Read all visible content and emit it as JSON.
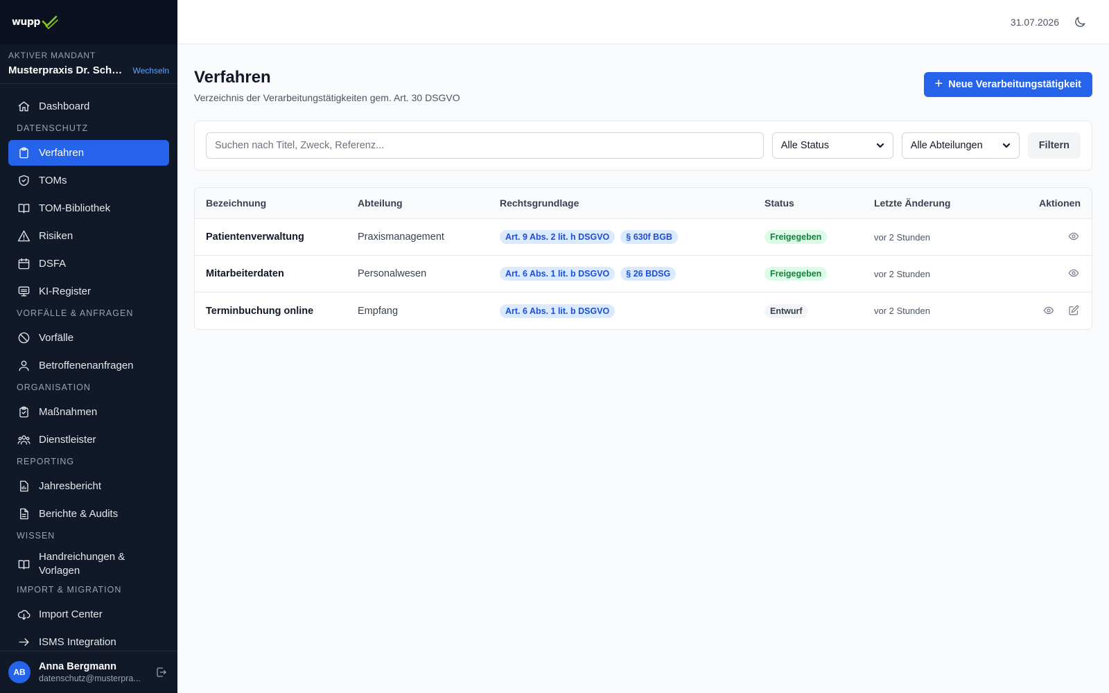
{
  "app": {
    "logo_text": "wupp"
  },
  "tenant": {
    "label": "AKTIVER MANDANT",
    "name": "Musterpraxis Dr. Schmi...",
    "switch_label": "Wechseln"
  },
  "sidebar": {
    "items": [
      {
        "type": "item",
        "label": "Dashboard",
        "icon": "home-icon"
      },
      {
        "type": "section",
        "label": "DATENSCHUTZ"
      },
      {
        "type": "item",
        "label": "Verfahren",
        "icon": "clipboard-icon",
        "active": true
      },
      {
        "type": "item",
        "label": "TOMs",
        "icon": "shield-icon"
      },
      {
        "type": "item",
        "label": "TOM-Bibliothek",
        "icon": "book-icon"
      },
      {
        "type": "item",
        "label": "Risiken",
        "icon": "warning-icon"
      },
      {
        "type": "item",
        "label": "DSFA",
        "icon": "calendar-icon"
      },
      {
        "type": "item",
        "label": "KI-Register",
        "icon": "monitor-icon"
      },
      {
        "type": "section",
        "label": "VORFÄLLE & ANFRAGEN"
      },
      {
        "type": "item",
        "label": "Vorfälle",
        "icon": "ban-icon"
      },
      {
        "type": "item",
        "label": "Betroffenenanfragen",
        "icon": "user-icon"
      },
      {
        "type": "section",
        "label": "ORGANISATION"
      },
      {
        "type": "item",
        "label": "Maßnahmen",
        "icon": "clipboard-check-icon"
      },
      {
        "type": "item",
        "label": "Dienstleister",
        "icon": "users-icon"
      },
      {
        "type": "section",
        "label": "REPORTING"
      },
      {
        "type": "item",
        "label": "Jahresbericht",
        "icon": "report-chart-icon"
      },
      {
        "type": "item",
        "label": "Berichte & Audits",
        "icon": "document-icon"
      },
      {
        "type": "section",
        "label": "WISSEN"
      },
      {
        "type": "item",
        "label": "Handreichungen & Vorlagen",
        "icon": "book-icon",
        "two_line": true
      },
      {
        "type": "section",
        "label": "IMPORT & MIGRATION"
      },
      {
        "type": "item",
        "label": "Import Center",
        "icon": "cloud-download-icon"
      },
      {
        "type": "item",
        "label": "ISMS Integration",
        "icon": "arrow-right-icon"
      }
    ]
  },
  "user": {
    "initials": "AB",
    "name": "Anna Bergmann",
    "email": "datenschutz@musterpra..."
  },
  "topbar": {
    "date": "31.07.2026",
    "theme_icon": "moon-icon"
  },
  "page": {
    "title": "Verfahren",
    "subtitle": "Verzeichnis der Verarbeitungstätigkeiten gem. Art. 30 DSGVO",
    "new_button_label": "Neue Verarbeitungstätigkeit"
  },
  "filters": {
    "search_placeholder": "Suchen nach Titel, Zweck, Referenz...",
    "status_selected": "Alle Status",
    "dept_selected": "Alle Abteilungen",
    "filter_button_label": "Filtern"
  },
  "table": {
    "columns": [
      "Bezeichnung",
      "Abteilung",
      "Rechtsgrundlage",
      "Status",
      "Letzte Änderung",
      "Aktionen"
    ],
    "rows": [
      {
        "name": "Patientenverwaltung",
        "dept": "Praxismanagement",
        "legal": [
          "Art. 9 Abs. 2 lit. h DSGVO",
          "§ 630f BGB"
        ],
        "status": "Freigegeben",
        "status_kind": "ok",
        "changed": "vor 2 Stunden",
        "actions": [
          "view"
        ]
      },
      {
        "name": "Mitarbeiterdaten",
        "dept": "Personalwesen",
        "legal": [
          "Art. 6 Abs. 1 lit. b DSGVO",
          "§ 26 BDSG"
        ],
        "status": "Freigegeben",
        "status_kind": "ok",
        "changed": "vor 2 Stunden",
        "actions": [
          "view"
        ]
      },
      {
        "name": "Terminbuchung online",
        "dept": "Empfang",
        "legal": [
          "Art. 6 Abs. 1 lit. b DSGVO"
        ],
        "status": "Entwurf",
        "status_kind": "draft",
        "changed": "vor 2 Stunden",
        "actions": [
          "view",
          "edit"
        ]
      }
    ]
  },
  "colors": {
    "primary": "#2563eb",
    "sidebar_bg": "#111827",
    "success_bg": "#dcfce7",
    "success_text": "#15803d",
    "tag_bg": "#dbeafe",
    "tag_text": "#1d4ed8"
  }
}
